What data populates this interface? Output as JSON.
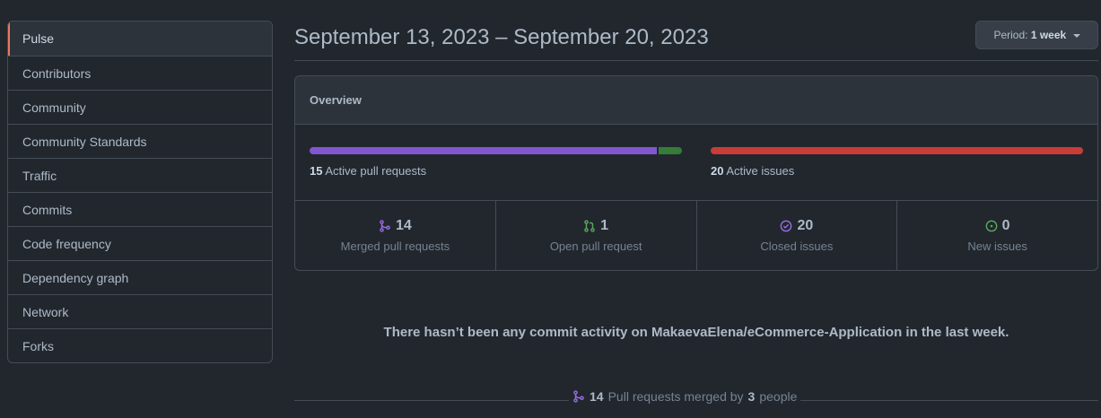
{
  "sidebar": {
    "items": [
      {
        "label": "Pulse",
        "selected": true
      },
      {
        "label": "Contributors"
      },
      {
        "label": "Community"
      },
      {
        "label": "Community Standards"
      },
      {
        "label": "Traffic"
      },
      {
        "label": "Commits"
      },
      {
        "label": "Code frequency"
      },
      {
        "label": "Dependency graph"
      },
      {
        "label": "Network"
      },
      {
        "label": "Forks"
      }
    ]
  },
  "header": {
    "date_range": "September 13, 2023 – September 20, 2023",
    "period_label": "Period:",
    "period_value": "1 week"
  },
  "overview": {
    "title": "Overview",
    "pull_requests": {
      "count": "15",
      "label": "Active pull requests",
      "merged_fraction": 0.933,
      "open_fraction": 0.067
    },
    "issues": {
      "count": "20",
      "label": "Active issues",
      "closed_fraction": 1.0
    },
    "stats": [
      {
        "icon": "merge-icon",
        "count": "14",
        "label": "Merged pull requests",
        "color": "#986ee2"
      },
      {
        "icon": "pull-request-icon",
        "count": "1",
        "label": "Open pull request",
        "color": "#57ab5a"
      },
      {
        "icon": "issue-closed-icon",
        "count": "20",
        "label": "Closed issues",
        "color": "#986ee2"
      },
      {
        "icon": "issue-open-icon",
        "count": "0",
        "label": "New issues",
        "color": "#57ab5a"
      }
    ]
  },
  "commit_activity": {
    "message": "There hasn’t been any commit activity on MakaevaElena/eCommerce-Application in the last week."
  },
  "merged_summary": {
    "count": "14",
    "text_a": "Pull requests merged by",
    "people": "3",
    "text_b": "people"
  },
  "colors": {
    "background": "#22272e",
    "border": "#444c56",
    "accent_selected": "#ec775c",
    "merged": "#8256d0",
    "open": "#347d39",
    "issues": "#c93c37"
  }
}
